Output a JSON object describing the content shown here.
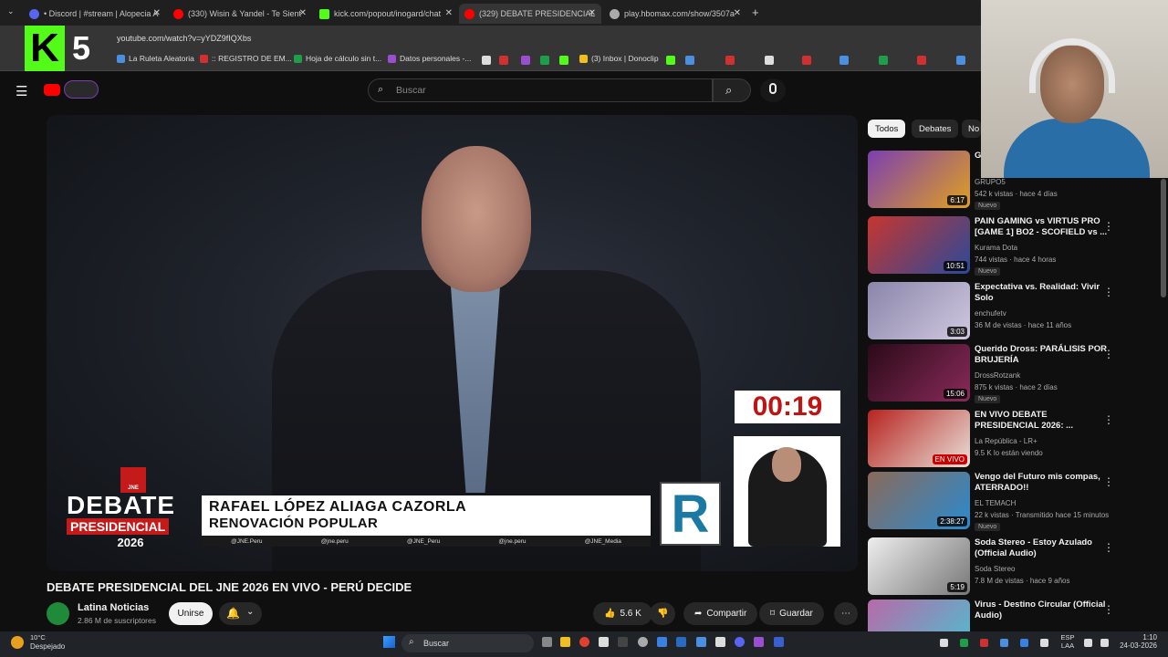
{
  "browser": {
    "tabs": [
      {
        "label": "• Discord | #stream | Alopecia A",
        "color": "#5865f2"
      },
      {
        "label": "(330) Wisin & Yandel - Te Sient",
        "color": "#ff0000"
      },
      {
        "label": "kick.com/popout/inogard/chat",
        "color": "#53fc18"
      },
      {
        "label": "(329) DEBATE PRESIDENCIAL",
        "color": "#ff0000"
      },
      {
        "label": "play.hbomax.com/show/3507a",
        "color": "#aaaaaa"
      }
    ],
    "url": "youtube.com/watch?v=yYDZ9fIQXbs",
    "bookmarks": [
      "La Ruleta Aleatoria",
      ":: REGISTRO DE EM...",
      "Hoja de cálculo sin t...",
      "Datos personales -...",
      "(3) Inbox | Donoclip"
    ]
  },
  "overlay": {
    "k_letter": "K",
    "k_number": "5"
  },
  "youtube": {
    "search_placeholder": "Buscar",
    "video": {
      "timer": "00:19",
      "name": "RAFAEL LÓPEZ ALIAGA CAZORLA",
      "party": "RENOVACIÓN POPULAR",
      "debate_line1": "DEBATE",
      "debate_line2": "PRESIDENCIAL",
      "debate_year": "2026",
      "jne": "JNE",
      "r_logo": "R",
      "socials": [
        "@JNE.Peru",
        "@jne.peru",
        "@JNE_Peru",
        "@jne.peru",
        "@JNE_Media"
      ]
    },
    "title": "DEBATE PRESIDENCIAL DEL JNE 2026 EN VIVO - PERÚ DECIDE",
    "channel": {
      "name": "Latina Noticias",
      "subs": "2.86 M de suscriptores",
      "join": "Unirse"
    },
    "actions": {
      "likes": "5.6 K",
      "share": "Compartir",
      "save": "Guardar"
    },
    "chips": [
      "Todos",
      "Debates",
      "No"
    ],
    "recommended": [
      {
        "title": "G L",
        "channel": "GRUPO5",
        "meta": "542 k vistas · hace 4 días",
        "badge": "Nuevo",
        "duration": "6:17",
        "color": "#7b3fb0"
      },
      {
        "title": "PAIN GAMING vs VIRTUS PRO [GAME 1] BO2 - SCOFIELD vs ...",
        "channel": "Kurama Dota",
        "meta": "744 vistas · hace 4 horas",
        "badge": "Nuevo",
        "duration": "10:51",
        "color": "#c7352f"
      },
      {
        "title": "Expectativa vs. Realidad: Vivir Solo",
        "channel": "enchufetv",
        "meta": "36 M de vistas · hace 11 años",
        "badge": "",
        "duration": "3:03",
        "color": "#6e6a8a"
      },
      {
        "title": "Querido Dross: PARÁLISIS POR BRUJERÍA",
        "channel": "DrossRotzank",
        "meta": "875 k vistas · hace 2 días",
        "badge": "Nuevo",
        "duration": "15:06",
        "color": "#5a1b2f"
      },
      {
        "title": "EN VIVO DEBATE PRESIDENCIAL 2026: ...",
        "channel": "La República - LR+",
        "meta": "9.5 K lo están viendo",
        "badge": "",
        "duration": "EN VIVO",
        "color": "#b8231f"
      },
      {
        "title": "Vengo del Futuro mis compas, ATERRADO!!",
        "channel": "EL TEMACH",
        "meta": "22 k vistas · Transmitido hace 15 minutos",
        "badge": "Nuevo",
        "duration": "2:38:27",
        "color": "#8a6a5a"
      },
      {
        "title": "Soda Stereo - Estoy Azulado (Official Audio)",
        "channel": "Soda Stereo",
        "meta": "7.8 M de vistas · hace 9 años",
        "badge": "",
        "duration": "5:19",
        "color": "#8a8a8a"
      },
      {
        "title": "Virus - Destino Circular (Official Audio)",
        "channel": "",
        "meta": "",
        "badge": "",
        "duration": "",
        "color": "#b86aa8"
      }
    ]
  },
  "taskbar": {
    "temp": "10°C",
    "weather": "Despejado",
    "search": "Buscar",
    "lang1": "ESP",
    "lang2": "LAA",
    "time": "1:10",
    "date": "24-03-2026"
  }
}
